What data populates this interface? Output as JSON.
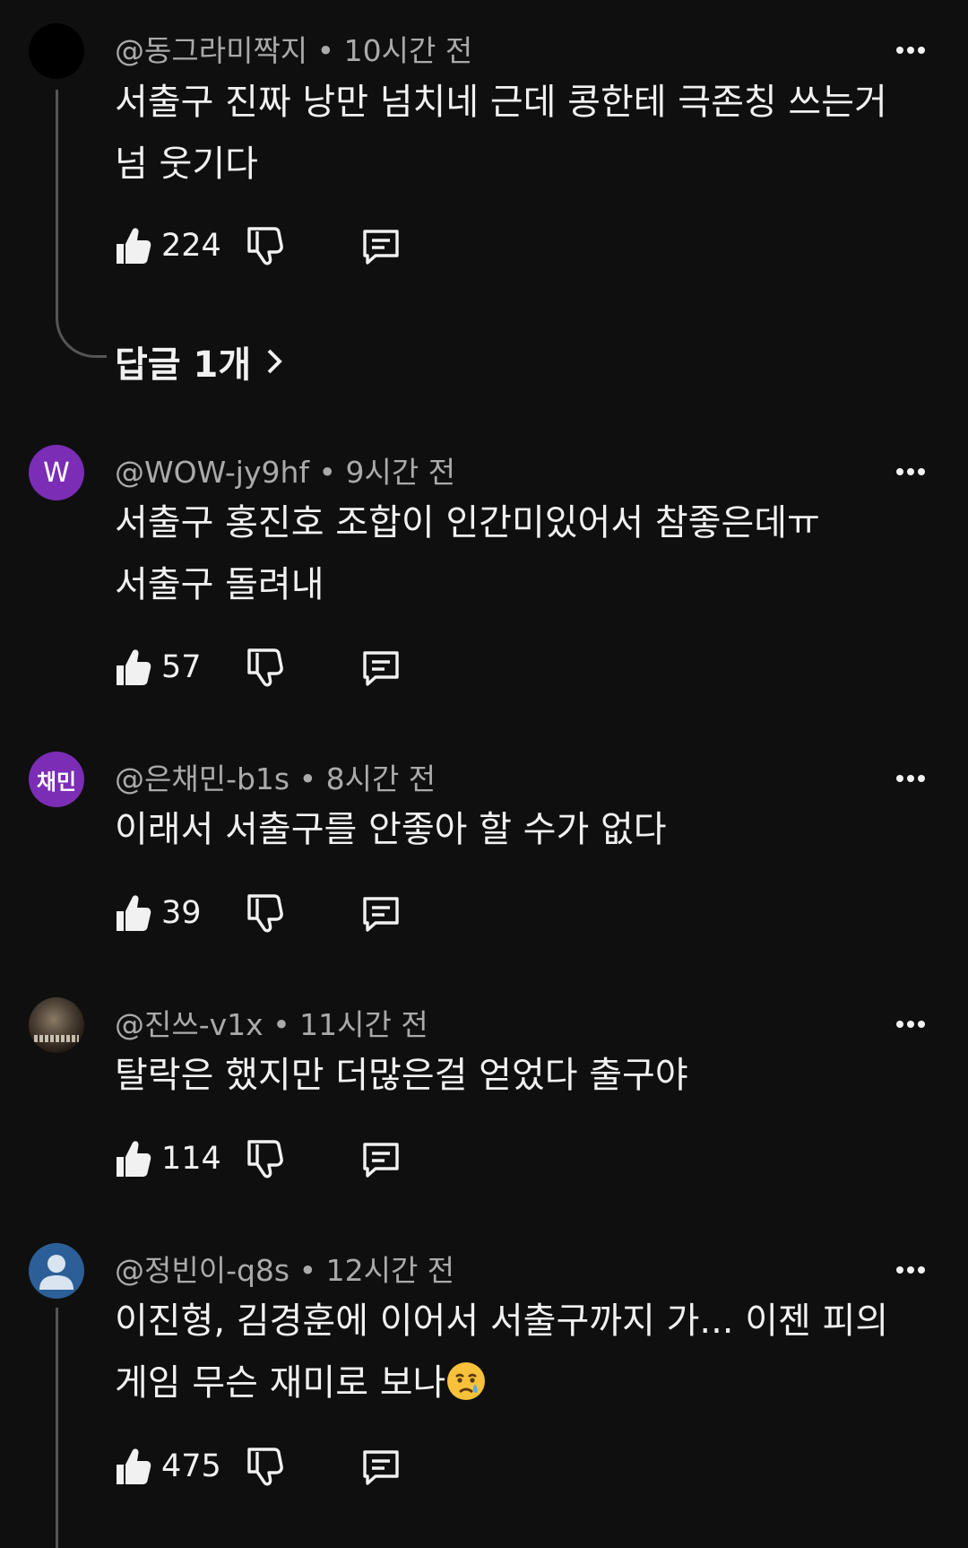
{
  "icons": {
    "like": "thumbs-up-icon",
    "dislike": "thumbs-down-icon",
    "reply": "comment-reply-icon",
    "more": "more-vertical-icon"
  },
  "comments": [
    {
      "avatar_text": "",
      "author": "@동그라미짝지",
      "time": "10시간 전",
      "line1": "서출구 진짜 낭만 넘치네 근데  콩한테 극존칭 쓰는거",
      "line2": "넘 웃기다",
      "likes": "224",
      "replies_label": "답글 1개"
    },
    {
      "avatar_text": "W",
      "author": "@WOW-jy9hf",
      "time": "9시간 전",
      "line1": "서출구 홍진호 조합이 인간미있어서 참좋은데ㅠ",
      "line2": "서출구 돌려내",
      "likes": "57"
    },
    {
      "avatar_text": "채민",
      "author": "@은채민-b1s",
      "time": "8시간 전",
      "line1": "이래서 서출구를 안좋아 할 수가 없다",
      "likes": "39"
    },
    {
      "avatar_text": "",
      "author": "@진쓰-v1x",
      "time": "11시간 전",
      "line1": "탈락은 했지만 더많은걸 얻었다 출구야",
      "likes": "114"
    },
    {
      "avatar_text": "",
      "author": "@정빈이-q8s",
      "time": "12시간 전",
      "line1": "이진형, 김경훈에 이어서 서출구까지 가... 이젠 피의",
      "line2": "게임 무슨 재미로 보나",
      "likes": "475"
    }
  ]
}
